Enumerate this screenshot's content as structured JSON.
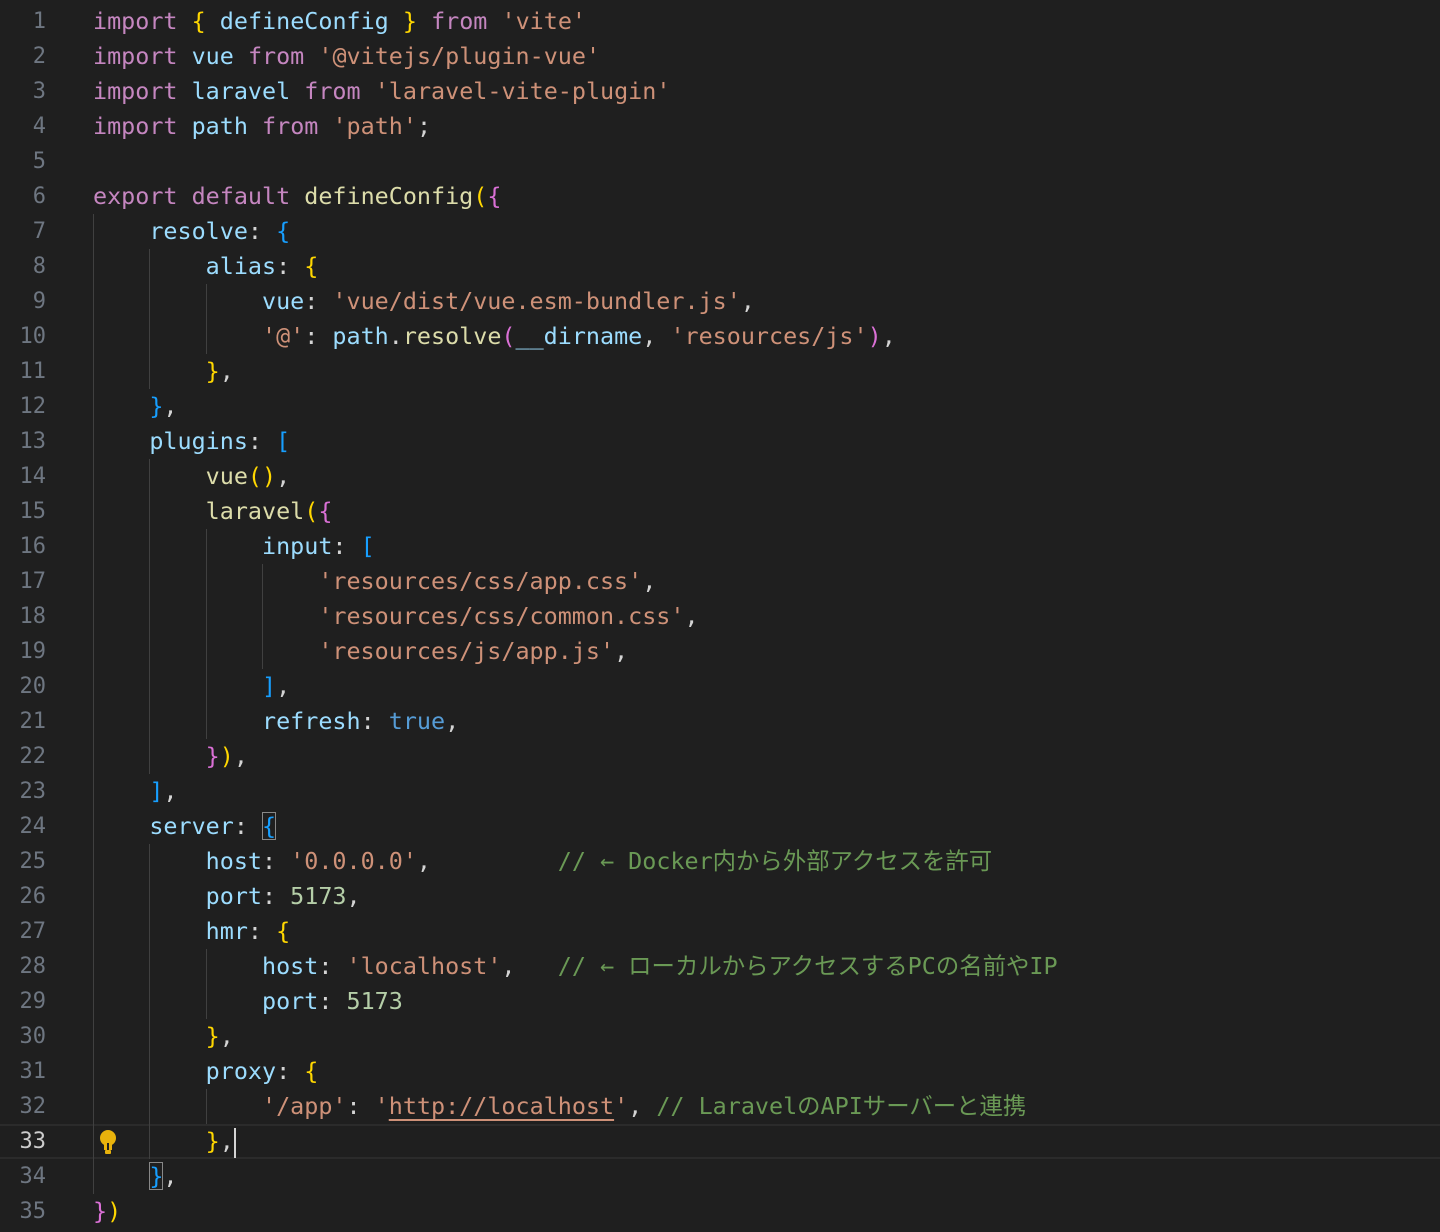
{
  "editor": {
    "active_line": 33,
    "lightbulb_line": 33,
    "lines": [
      {
        "n": "1",
        "i": 0,
        "t": [
          [
            "kw",
            "import"
          ],
          [
            "p",
            " "
          ],
          [
            "b1",
            "{"
          ],
          [
            "p",
            " "
          ],
          [
            "var",
            "defineConfig"
          ],
          [
            "p",
            " "
          ],
          [
            "b1",
            "}"
          ],
          [
            "p",
            " "
          ],
          [
            "kw",
            "from"
          ],
          [
            "p",
            " "
          ],
          [
            "str",
            "'vite'"
          ]
        ]
      },
      {
        "n": "2",
        "i": 0,
        "t": [
          [
            "kw",
            "import"
          ],
          [
            "p",
            " "
          ],
          [
            "var",
            "vue"
          ],
          [
            "p",
            " "
          ],
          [
            "kw",
            "from"
          ],
          [
            "p",
            " "
          ],
          [
            "str",
            "'@vitejs/plugin-vue'"
          ]
        ]
      },
      {
        "n": "3",
        "i": 0,
        "t": [
          [
            "kw",
            "import"
          ],
          [
            "p",
            " "
          ],
          [
            "var",
            "laravel"
          ],
          [
            "p",
            " "
          ],
          [
            "kw",
            "from"
          ],
          [
            "p",
            " "
          ],
          [
            "str",
            "'laravel-vite-plugin'"
          ]
        ]
      },
      {
        "n": "4",
        "i": 0,
        "t": [
          [
            "kw",
            "import"
          ],
          [
            "p",
            " "
          ],
          [
            "var",
            "path"
          ],
          [
            "p",
            " "
          ],
          [
            "kw",
            "from"
          ],
          [
            "p",
            " "
          ],
          [
            "str",
            "'path'"
          ],
          [
            "p",
            ";"
          ]
        ]
      },
      {
        "n": "5",
        "i": 0,
        "t": []
      },
      {
        "n": "6",
        "i": 0,
        "t": [
          [
            "kw",
            "export"
          ],
          [
            "p",
            " "
          ],
          [
            "kw",
            "default"
          ],
          [
            "p",
            " "
          ],
          [
            "fn",
            "defineConfig"
          ],
          [
            "b1",
            "("
          ],
          [
            "b2",
            "{"
          ]
        ]
      },
      {
        "n": "7",
        "i": 1,
        "t": [
          [
            "var",
            "resolve"
          ],
          [
            "p",
            ": "
          ],
          [
            "b3",
            "{"
          ]
        ]
      },
      {
        "n": "8",
        "i": 2,
        "t": [
          [
            "var",
            "alias"
          ],
          [
            "p",
            ": "
          ],
          [
            "b1",
            "{"
          ]
        ]
      },
      {
        "n": "9",
        "i": 3,
        "t": [
          [
            "var",
            "vue"
          ],
          [
            "p",
            ": "
          ],
          [
            "str",
            "'vue/dist/vue.esm-bundler.js'"
          ],
          [
            "p",
            ","
          ]
        ]
      },
      {
        "n": "10",
        "i": 3,
        "t": [
          [
            "str",
            "'@'"
          ],
          [
            "p",
            ": "
          ],
          [
            "var",
            "path"
          ],
          [
            "p",
            "."
          ],
          [
            "fn",
            "resolve"
          ],
          [
            "b2",
            "("
          ],
          [
            "var",
            "__dirname"
          ],
          [
            "p",
            ", "
          ],
          [
            "str",
            "'resources/js'"
          ],
          [
            "b2",
            ")"
          ],
          [
            "p",
            ","
          ]
        ]
      },
      {
        "n": "11",
        "i": 2,
        "t": [
          [
            "b1",
            "}"
          ],
          [
            "p",
            ","
          ]
        ]
      },
      {
        "n": "12",
        "i": 1,
        "t": [
          [
            "b3",
            "}"
          ],
          [
            "p",
            ","
          ]
        ]
      },
      {
        "n": "13",
        "i": 1,
        "t": [
          [
            "var",
            "plugins"
          ],
          [
            "p",
            ": "
          ],
          [
            "b3",
            "["
          ]
        ]
      },
      {
        "n": "14",
        "i": 2,
        "t": [
          [
            "fn",
            "vue"
          ],
          [
            "b1",
            "()"
          ],
          [
            "p",
            ","
          ]
        ]
      },
      {
        "n": "15",
        "i": 2,
        "t": [
          [
            "fn",
            "laravel"
          ],
          [
            "b1",
            "("
          ],
          [
            "b2",
            "{"
          ]
        ]
      },
      {
        "n": "16",
        "i": 3,
        "t": [
          [
            "var",
            "input"
          ],
          [
            "p",
            ": "
          ],
          [
            "b3",
            "["
          ]
        ]
      },
      {
        "n": "17",
        "i": 4,
        "t": [
          [
            "str",
            "'resources/css/app.css'"
          ],
          [
            "p",
            ","
          ]
        ]
      },
      {
        "n": "18",
        "i": 4,
        "t": [
          [
            "str",
            "'resources/css/common.css'"
          ],
          [
            "p",
            ","
          ]
        ]
      },
      {
        "n": "19",
        "i": 4,
        "t": [
          [
            "str",
            "'resources/js/app.js'"
          ],
          [
            "p",
            ","
          ]
        ]
      },
      {
        "n": "20",
        "i": 3,
        "t": [
          [
            "b3",
            "]"
          ],
          [
            "p",
            ","
          ]
        ]
      },
      {
        "n": "21",
        "i": 3,
        "t": [
          [
            "var",
            "refresh"
          ],
          [
            "p",
            ": "
          ],
          [
            "kw2",
            "true"
          ],
          [
            "p",
            ","
          ]
        ]
      },
      {
        "n": "22",
        "i": 2,
        "t": [
          [
            "b2",
            "}"
          ],
          [
            "b1",
            ")"
          ],
          [
            "p",
            ","
          ]
        ]
      },
      {
        "n": "23",
        "i": 1,
        "t": [
          [
            "b3",
            "]"
          ],
          [
            "p",
            ","
          ]
        ]
      },
      {
        "n": "24",
        "i": 1,
        "t": [
          [
            "var",
            "server"
          ],
          [
            "p",
            ": "
          ],
          [
            "b3",
            "{",
            "match"
          ]
        ]
      },
      {
        "n": "25",
        "i": 2,
        "t": [
          [
            "var",
            "host"
          ],
          [
            "p",
            ": "
          ],
          [
            "str",
            "'0.0.0.0'"
          ],
          [
            "p",
            ",         "
          ],
          [
            "com",
            "// ← Docker内から外部アクセスを許可"
          ]
        ]
      },
      {
        "n": "26",
        "i": 2,
        "t": [
          [
            "var",
            "port"
          ],
          [
            "p",
            ": "
          ],
          [
            "num",
            "5173"
          ],
          [
            "p",
            ","
          ]
        ]
      },
      {
        "n": "27",
        "i": 2,
        "t": [
          [
            "var",
            "hmr"
          ],
          [
            "p",
            ": "
          ],
          [
            "b1",
            "{"
          ]
        ]
      },
      {
        "n": "28",
        "i": 3,
        "t": [
          [
            "var",
            "host"
          ],
          [
            "p",
            ": "
          ],
          [
            "str",
            "'localhost'"
          ],
          [
            "p",
            ",   "
          ],
          [
            "com",
            "// ← ローカルからアクセスするPCの名前やIP"
          ]
        ]
      },
      {
        "n": "29",
        "i": 3,
        "t": [
          [
            "var",
            "port"
          ],
          [
            "p",
            ": "
          ],
          [
            "num",
            "5173"
          ]
        ]
      },
      {
        "n": "30",
        "i": 2,
        "t": [
          [
            "b1",
            "}"
          ],
          [
            "p",
            ","
          ]
        ]
      },
      {
        "n": "31",
        "i": 2,
        "t": [
          [
            "var",
            "proxy"
          ],
          [
            "p",
            ": "
          ],
          [
            "b1",
            "{"
          ]
        ]
      },
      {
        "n": "32",
        "i": 3,
        "t": [
          [
            "str",
            "'/app'"
          ],
          [
            "p",
            ": "
          ],
          [
            "str",
            "'"
          ],
          [
            "url",
            "http://localhost"
          ],
          [
            "str",
            "'"
          ],
          [
            "p",
            ", "
          ],
          [
            "com",
            "// LaravelのAPIサーバーと連携"
          ]
        ]
      },
      {
        "n": "33",
        "i": 2,
        "t": [
          [
            "b1",
            "}"
          ],
          [
            "p",
            ","
          ]
        ],
        "cursor": true
      },
      {
        "n": "34",
        "i": 1,
        "t": [
          [
            "b3",
            "}",
            "match"
          ],
          [
            "p",
            ","
          ]
        ]
      },
      {
        "n": "35",
        "i": 0,
        "t": [
          [
            "b2",
            "}"
          ],
          [
            "b1",
            ")"
          ]
        ]
      }
    ]
  }
}
